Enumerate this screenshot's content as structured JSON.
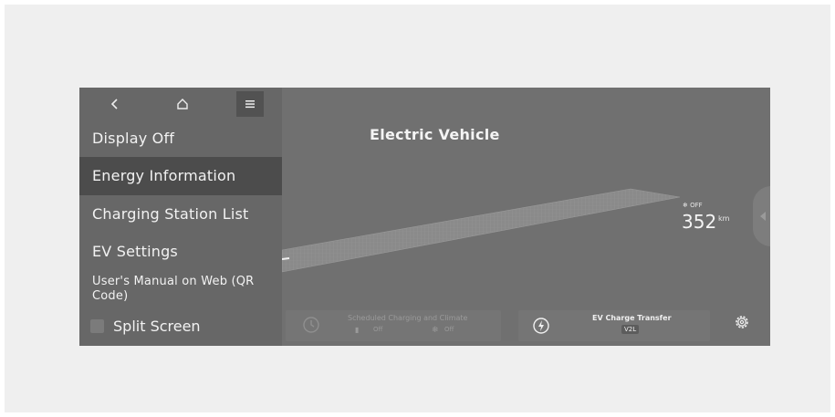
{
  "topbar": {
    "back_icon": "chevron-left-icon",
    "home_icon": "home-icon",
    "menu_icon": "menu-icon"
  },
  "sidebar": {
    "items": [
      {
        "label": "Display Off"
      },
      {
        "label": "Energy Information",
        "selected": true
      },
      {
        "label": "Charging Station List"
      },
      {
        "label": "EV Settings"
      },
      {
        "label": "User's Manual on Web (QR Code)"
      }
    ],
    "split_screen": {
      "label": "Split Screen",
      "checked": false
    }
  },
  "main": {
    "title": "Electric Vehicle",
    "range": {
      "icon": "❄ OFF",
      "value": "352",
      "unit": "km"
    }
  },
  "bottom_bar": {
    "scheduled": {
      "title": "Scheduled Charging and Climate",
      "charging_status": "Off",
      "climate_status": "Off"
    },
    "ev_charge_transfer": {
      "title": "EV Charge Transfer",
      "badge": "V2L"
    },
    "settings_icon": "gear-icon"
  },
  "colors": {
    "screen_bg": "#707070",
    "sidebar_bg": "#676767",
    "selected_bg": "#4c4c4c",
    "text": "#f2f2f2"
  }
}
